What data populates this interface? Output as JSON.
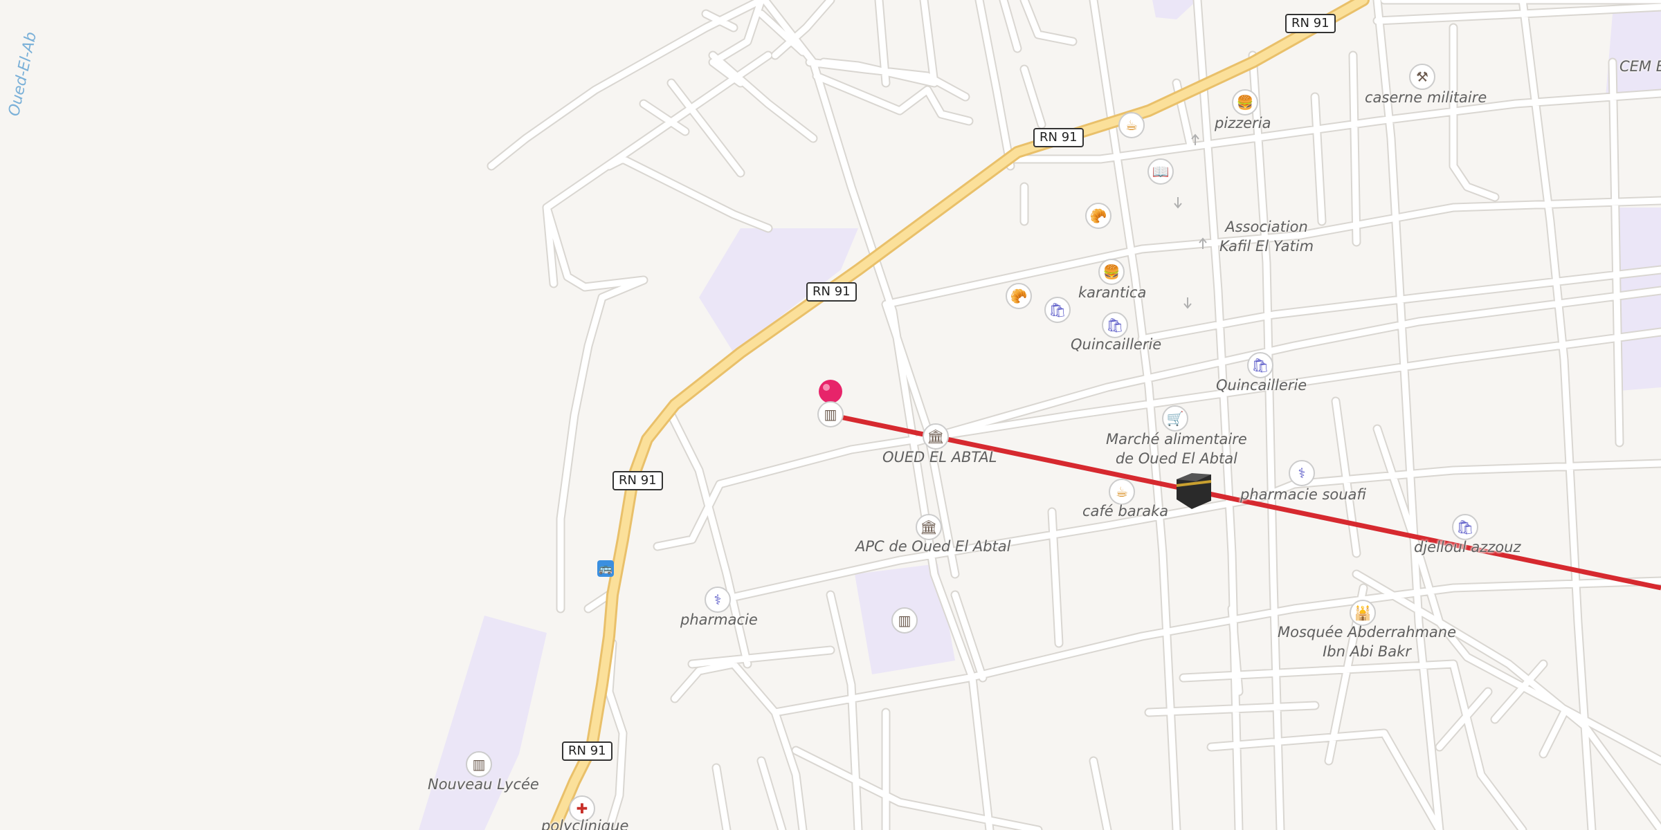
{
  "map": {
    "water_label": "Oued-El-Ab",
    "road_shields": [
      "RN 91",
      "RN 91",
      "RN 91",
      "RN 91",
      "RN 91"
    ],
    "place_labels": {
      "cem": "CEM E",
      "caserne": "caserne militaire",
      "pizzeria": "pizzeria",
      "association": "Association\nKafil El Yatim",
      "karantica": "karantica",
      "quincaillerie_1": "Quincaillerie",
      "quincaillerie_2": "Quincaillerie",
      "marche": "Marché alimentaire\nde Oued El Abtal",
      "oued_el_abtal": "OUED EL ABTAL",
      "pharmacie_souafi": "pharmacie souafi",
      "cafe_baraka": "café baraka",
      "djelloul": "djelloul azzouz",
      "apc": "APC de Oued El Abtal",
      "pharmacie": "pharmacie",
      "mosquee": "Mosquée Abderrahmane\nIbn Abi Bakr",
      "nouveau_lycee": "Nouveau Lycée",
      "polyclinique": "polyclinique"
    },
    "colors": {
      "background": "#f7f5f2",
      "road": "#ffffff",
      "road_casing": "#d9d6d1",
      "primary_road": "#fbe09a",
      "primary_casing": "#e9c06a",
      "landuse": "#ebe6f7",
      "qibla_line": "#d6292f",
      "marker": "#e7246a"
    },
    "icons": [
      "coffee-icon",
      "burger-icon",
      "book-icon",
      "bakery-icon",
      "basket-icon",
      "cart-icon",
      "townhall-icon",
      "pharmacy-icon",
      "school-icon",
      "mosque-icon",
      "kaaba-icon",
      "bus-stop-icon",
      "hospital-icon",
      "military-icon",
      "map-pin-icon"
    ]
  }
}
